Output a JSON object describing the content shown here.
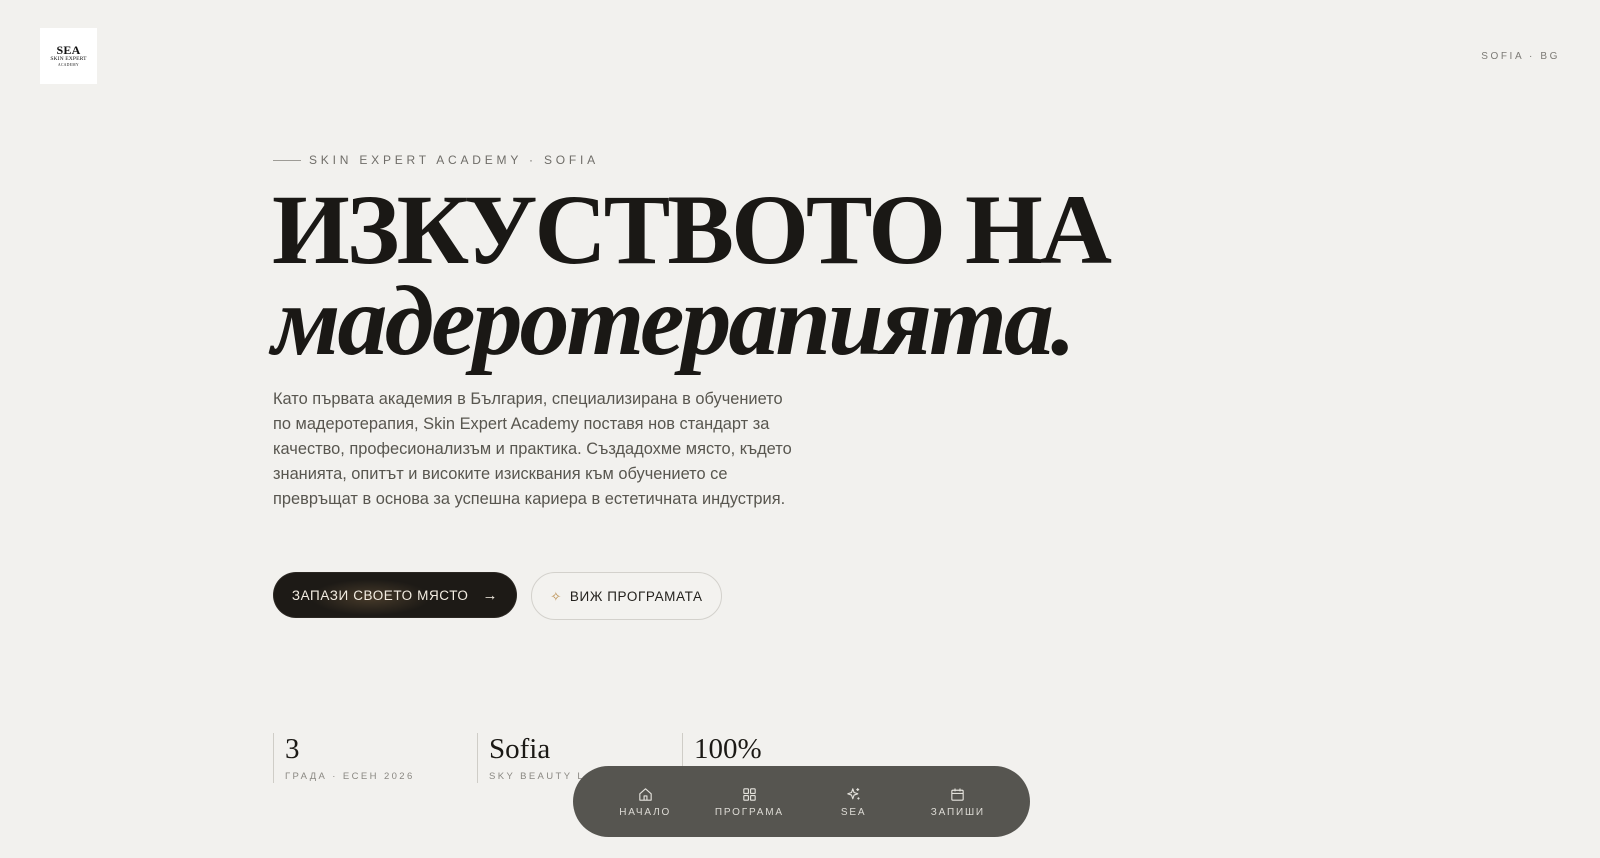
{
  "brand": {
    "logo_line1": "SEA",
    "logo_line2": "SKIN EXPERT",
    "logo_line3": "ACADEMY",
    "locale": "SOFIA · BG"
  },
  "hero": {
    "eyebrow": "SKIN EXPERT ACADEMY · SOFIA",
    "title_line1": "ИЗКУСТВОТО НА",
    "title_line2": "мадеротерапията.",
    "lead": "Като първата академия в България, специализирана в обучението по мадеротерапия, Skin Expert Academy поставя нов стандарт за качество, професионализъм и практика. Създадохме място, където знанията, опитът и високите изисквания към обучението се превръщат в основа за успешна кариера в естетичната индустрия.",
    "primary_cta": "ЗАПАЗИ СВОЕТО МЯСТО",
    "secondary_cta": "ВИЖ ПРОГРАМАТА"
  },
  "stats": [
    {
      "value": "3",
      "label": "ГРАДА · ЕСЕН 2026"
    },
    {
      "value": "Sofia",
      "label": "SKY BEAUTY L"
    },
    {
      "value": "100%",
      "label": ""
    }
  ],
  "dock": {
    "items": [
      {
        "label": "НАЧАЛО",
        "icon": "home-icon"
      },
      {
        "label": "ПРОГРАМА",
        "icon": "grid-icon"
      },
      {
        "label": "SEA",
        "icon": "sparkle-icon"
      },
      {
        "label": "ЗАПИШИ",
        "icon": "calendar-icon"
      }
    ]
  },
  "colors": {
    "background": "#f2f1ee",
    "ink": "#1c1a17",
    "accent_gold": "#b98b4a",
    "dock": "#565550"
  }
}
